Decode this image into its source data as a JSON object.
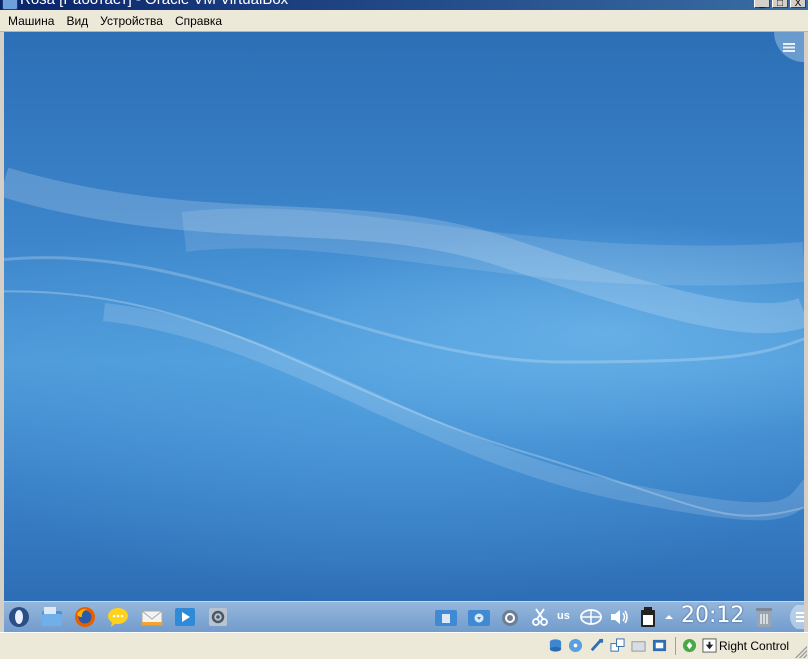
{
  "window": {
    "title": "Rosa [Работает] - Oracle VM VirtualBox",
    "controls": {
      "minimize": "_",
      "maximize": "□",
      "close": "X"
    }
  },
  "menu": {
    "items": [
      "Машина",
      "Вид",
      "Устройства",
      "Справка"
    ]
  },
  "guest": {
    "desktop_corner_icon": "desktop-toolbox-icon",
    "panel": {
      "launchers": [
        "rosa-menu-icon",
        "file-manager-icon",
        "firefox-icon",
        "chat-icon",
        "mail-icon",
        "media-player-icon",
        "settings-icon"
      ],
      "tray": [
        "folder-documents-icon",
        "folder-downloads-icon",
        "update-icon",
        "clipboard-scissors-icon"
      ],
      "keyboard_layout": "us",
      "tray2": [
        "network-icon",
        "volume-icon",
        "battery-icon",
        "show-hidden-icon"
      ],
      "clock": "20:12",
      "trash": "trash-icon"
    }
  },
  "statusbar": {
    "icons": [
      "hard-disk-icon",
      "optical-drive-icon",
      "usb-icon",
      "network-adapters-icon",
      "shared-folders-icon",
      "video-capture-icon",
      "mouse-integration-icon"
    ],
    "host_key_icon": "host-key-arrow-icon",
    "host_key_label": "Right Control"
  },
  "colors": {
    "desktop_blue": "#3d86cc",
    "menubar_bg": "#ece9d8",
    "titlebar_blue": "#0a246a"
  }
}
